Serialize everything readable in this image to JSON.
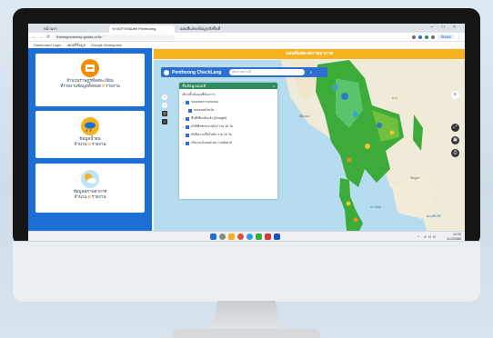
{
  "browser": {
    "tabs": [
      {
        "label": "หน้าแรก"
      },
      {
        "label": "ระบบสารสนเทศ Penthuong"
      },
      {
        "label": "แผนที่แสดงข้อมูลเชิงพื้นที่"
      }
    ],
    "window_controls": "–  □  ×",
    "url": "thairegionalmap.gistda.or.th/",
    "update_label": "อัปเดต",
    "bookmarks": [
      "Dashboard Login",
      "แผนที่ข้อมูล",
      "Google Workspace"
    ]
  },
  "sidebar": {
    "cards": [
      {
        "title": "จำนวนราษฎรที่ลงทะเบียน",
        "subtitle": "ที่รายงานข้อมูลทั้งหมด",
        "count": "0",
        "unit": "รายงาน",
        "icon": "inbox-icon",
        "color": "#f28c00"
      },
      {
        "title": "ข้อมูลน้ำฝน",
        "subtitle": "จำนวน",
        "count": "0",
        "unit": "รายงาน",
        "icon": "cloud-rain-icon",
        "color": "#f5b21e"
      },
      {
        "title": "ข้อมูลสภาพอากาศ",
        "subtitle": "จำนวน",
        "count": "0",
        "unit": "รายงาน",
        "icon": "sun-cloud-icon",
        "color": "#4aa3df"
      }
    ]
  },
  "banner": "แผนที่แสดงสภาพอากาศ",
  "map": {
    "app_title": "Penthuong CheckLang",
    "search_placeholder": "ค้นหาสถานที่",
    "layers_header": "ชั้นข้อมูลแผนที่",
    "layers_sub": "เลือกชั้นข้อมูลที่ต้องการ",
    "layers": [
      {
        "label": "ขอบเขตการปกครอง",
        "level": 0
      },
      {
        "label": "ขอบเขตจังหวัด",
        "level": 1
      },
      {
        "label": "พื้นที่เสี่ยงภัยแล้ง (Drought)",
        "level": 0
      },
      {
        "label": "ดัชนีพืชพรรณ NDVI ราย 16 วัน",
        "level": 0
      },
      {
        "label": "ดัชนีความชื้นในดิน ราย 16 วัน",
        "level": 0
      },
      {
        "label": "ปริมาณน้ำฝนสะสม รายสัปดาห์",
        "level": 0
      }
    ],
    "place_labels": [
      "เมียนมา",
      "ลาว",
      "กัมพูชา",
      "ทะเลจีนใต้",
      "อ่าวไทย"
    ],
    "right_tools": [
      "layers-icon",
      "zoom-icon",
      "fullscreen-icon"
    ]
  },
  "taskbar": {
    "icons": [
      "windows-icon",
      "search-icon",
      "files-icon",
      "chrome-icon",
      "edge-icon",
      "store-icon",
      "mail-icon",
      "settings-icon"
    ],
    "tray": "^ ENG",
    "time": "12:30",
    "date": "1/12/2566"
  }
}
